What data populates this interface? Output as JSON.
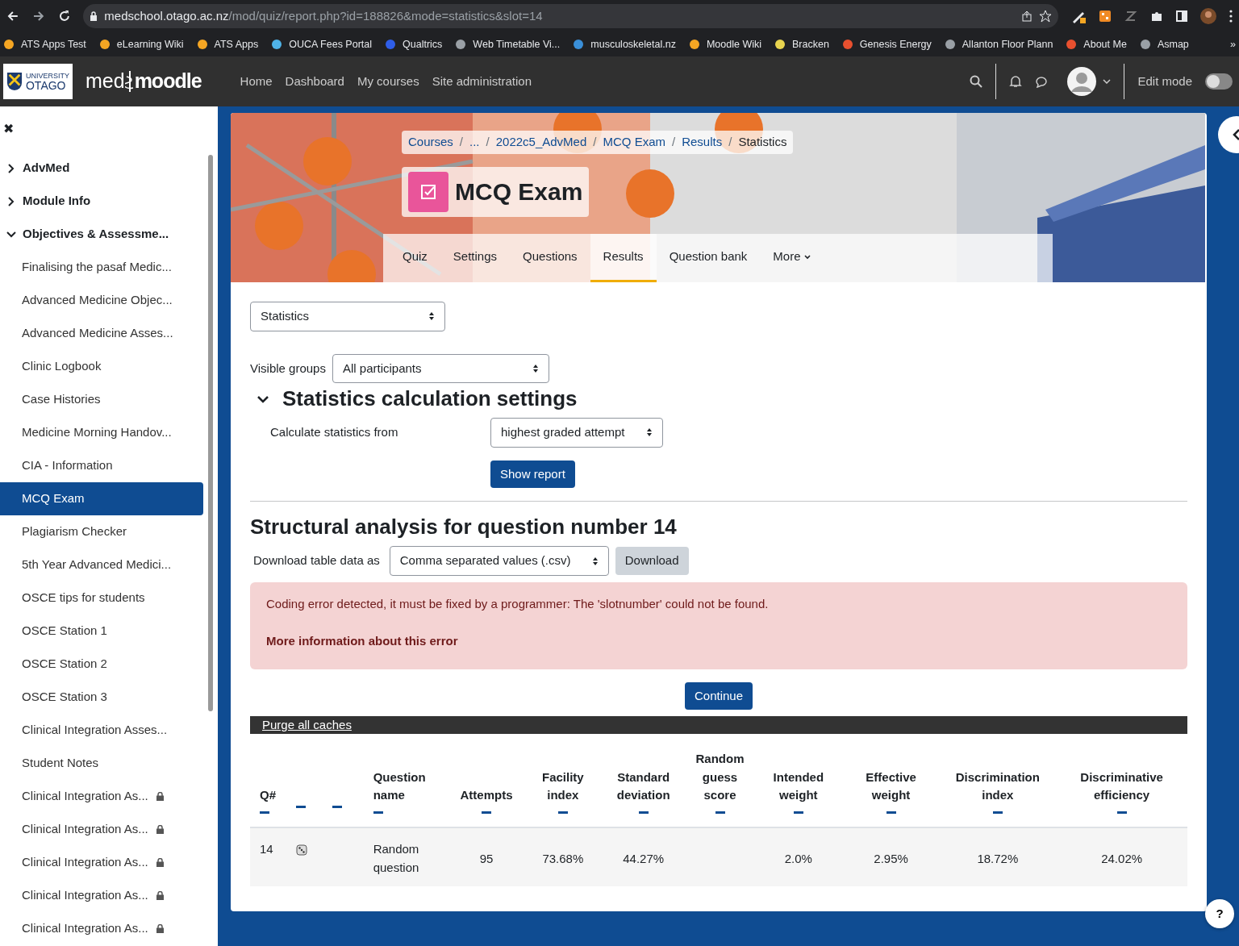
{
  "browser": {
    "url_host": "medschool.otago.ac.nz",
    "url_path": "/mod/quiz/report.php?id=188826&mode=statistics&slot=14",
    "bookmarks": [
      {
        "label": "ATS Apps Test",
        "color": "#f5a623"
      },
      {
        "label": "eLearning Wiki",
        "color": "#f5a623"
      },
      {
        "label": "ATS Apps",
        "color": "#f5a623"
      },
      {
        "label": "OUCA Fees Portal",
        "color": "#4fb3e8"
      },
      {
        "label": "Qualtrics",
        "color": "#2f5ee8"
      },
      {
        "label": "Web Timetable Vi...",
        "color": "#9aa0a6"
      },
      {
        "label": "musculoskeletal.nz",
        "color": "#3a8fd8"
      },
      {
        "label": "Moodle Wiki",
        "color": "#f5a623"
      },
      {
        "label": "Bracken",
        "color": "#e8d44f"
      },
      {
        "label": "Genesis Energy",
        "color": "#e8502f"
      },
      {
        "label": "Allanton Floor Plann",
        "color": "#9aa0a6"
      },
      {
        "label": "About Me",
        "color": "#e8502f"
      },
      {
        "label": "Asmap",
        "color": "#9aa0a6"
      }
    ],
    "more": "»"
  },
  "navbar": {
    "logo_top": "UNIVERSITY",
    "logo_name": "OTAGO",
    "brand_prefix": "med",
    "brand_name": "moodle",
    "links": [
      "Home",
      "Dashboard",
      "My courses",
      "Site administration"
    ],
    "edit_mode_label": "Edit mode",
    "edit_mode_on": false
  },
  "sidebar": {
    "close": "✖",
    "items": [
      {
        "kind": "section",
        "label": "AdvMed",
        "expanded": false
      },
      {
        "kind": "section",
        "label": "Module Info",
        "expanded": false
      },
      {
        "kind": "section",
        "label": "Objectives & Assessme...",
        "expanded": true
      },
      {
        "kind": "item",
        "label": "Finalising the pasaf Medic...",
        "selected": false,
        "locked": false
      },
      {
        "kind": "item",
        "label": "Advanced Medicine Objec...",
        "selected": false,
        "locked": false
      },
      {
        "kind": "item",
        "label": "Advanced Medicine Asses...",
        "selected": false,
        "locked": false
      },
      {
        "kind": "item",
        "label": "Clinic Logbook",
        "selected": false,
        "locked": false
      },
      {
        "kind": "item",
        "label": "Case Histories",
        "selected": false,
        "locked": false
      },
      {
        "kind": "item",
        "label": "Medicine Morning Handov...",
        "selected": false,
        "locked": false
      },
      {
        "kind": "item",
        "label": "CIA - Information",
        "selected": false,
        "locked": false
      },
      {
        "kind": "item",
        "label": "MCQ Exam",
        "selected": true,
        "locked": false
      },
      {
        "kind": "item",
        "label": "Plagiarism Checker",
        "selected": false,
        "locked": false
      },
      {
        "kind": "item",
        "label": "5th Year Advanced Medici...",
        "selected": false,
        "locked": false
      },
      {
        "kind": "item",
        "label": "OSCE tips for students",
        "selected": false,
        "locked": false
      },
      {
        "kind": "item",
        "label": "OSCE Station 1",
        "selected": false,
        "locked": false
      },
      {
        "kind": "item",
        "label": "OSCE Station 2",
        "selected": false,
        "locked": false
      },
      {
        "kind": "item",
        "label": "OSCE Station 3",
        "selected": false,
        "locked": false
      },
      {
        "kind": "item",
        "label": "Clinical Integration Asses...",
        "selected": false,
        "locked": false
      },
      {
        "kind": "item",
        "label": "Student Notes",
        "selected": false,
        "locked": false
      },
      {
        "kind": "item",
        "label": "Clinical Integration As...",
        "selected": false,
        "locked": true
      },
      {
        "kind": "item",
        "label": "Clinical Integration As...",
        "selected": false,
        "locked": true
      },
      {
        "kind": "item",
        "label": "Clinical Integration As...",
        "selected": false,
        "locked": true
      },
      {
        "kind": "item",
        "label": "Clinical Integration As...",
        "selected": false,
        "locked": true
      },
      {
        "kind": "item",
        "label": "Clinical Integration As...",
        "selected": false,
        "locked": true
      }
    ]
  },
  "header": {
    "breadcrumb": [
      "Courses",
      "...",
      "2022c5_AdvMed",
      "MCQ Exam",
      "Results",
      "Statistics"
    ],
    "breadcrumb_separator": "/",
    "title": "MCQ Exam",
    "tabs": [
      {
        "label": "Quiz",
        "selected": false
      },
      {
        "label": "Settings",
        "selected": false
      },
      {
        "label": "Questions",
        "selected": false
      },
      {
        "label": "Results",
        "selected": true
      },
      {
        "label": "Question bank",
        "selected": false
      },
      {
        "label": "More",
        "selected": false
      }
    ]
  },
  "report_select": "Statistics",
  "visible_groups": {
    "label": "Visible groups",
    "value": "All participants"
  },
  "settings": {
    "heading": "Statistics calculation settings",
    "expanded": true,
    "calc_label": "Calculate statistics from",
    "calc_value": "highest graded attempt",
    "button": "Show report"
  },
  "analysis": {
    "heading": "Structural analysis for question number 14",
    "download_label": "Download table data as",
    "download_value": "Comma separated values (.csv)",
    "download_button": "Download"
  },
  "alert": {
    "message": "Coding error detected, it must be fixed by a programmer: The 'slotnumber' could not be found.",
    "link": "More information about this error"
  },
  "continue_button": "Continue",
  "purge_link": "Purge all caches",
  "table": {
    "columns": [
      {
        "label": "Q#"
      },
      {},
      {},
      {
        "label": "Question name"
      },
      {
        "label": "Attempts"
      },
      {
        "label": "Facility index"
      },
      {
        "label": "Standard deviation"
      },
      {
        "label": "Random guess score"
      },
      {
        "label": "Intended weight"
      },
      {
        "label": "Effective weight"
      },
      {
        "label": "Discrimination index"
      },
      {
        "label": "Discriminative efficiency"
      }
    ],
    "rows": [
      {
        "kind": "random",
        "cells": [
          "14",
          null,
          null,
          "Random question",
          "95",
          "73.68%",
          "44.27%",
          null,
          "2.0%",
          "2.95%",
          "18.72%",
          "24.02%"
        ]
      }
    ]
  },
  "help": "?"
}
